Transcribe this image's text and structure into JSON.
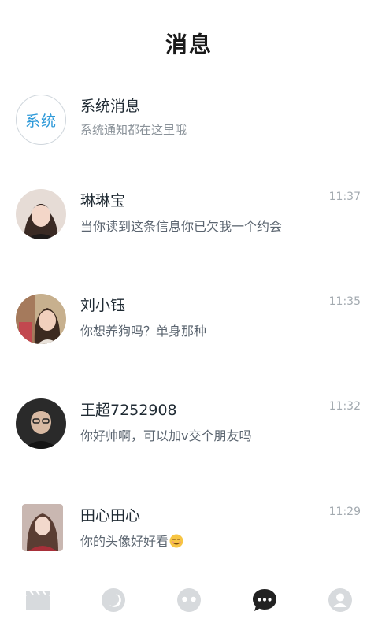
{
  "header": {
    "title": "消息"
  },
  "system": {
    "avatar_label": "系统",
    "name": "系统消息",
    "preview": "系统通知都在这里哦"
  },
  "conversations": [
    {
      "name": "琳琳宝",
      "preview": "当你读到这条信息你已欠我一个约会",
      "time": "11:37"
    },
    {
      "name": "刘小钰",
      "preview": "你想养狗吗？单身那种",
      "time": "11:35"
    },
    {
      "name": "王超7252908",
      "preview": "你好帅啊，可以加v交个朋友吗",
      "time": "11:32"
    },
    {
      "name": "田心田心",
      "preview": "你的头像好好看",
      "time": "11:29",
      "emoji": "smiling-face"
    }
  ],
  "tabbar": {
    "tabs": [
      {
        "icon": "video-clapper-icon",
        "active": false
      },
      {
        "icon": "moon-icon",
        "active": false
      },
      {
        "icon": "face-icon",
        "active": false
      },
      {
        "icon": "chat-bubble-icon",
        "active": true
      },
      {
        "icon": "person-icon",
        "active": false
      }
    ]
  },
  "colors": {
    "accent": "#2f9ad9",
    "active_tab": "#222222",
    "inactive_tab": "#d7dadd"
  }
}
